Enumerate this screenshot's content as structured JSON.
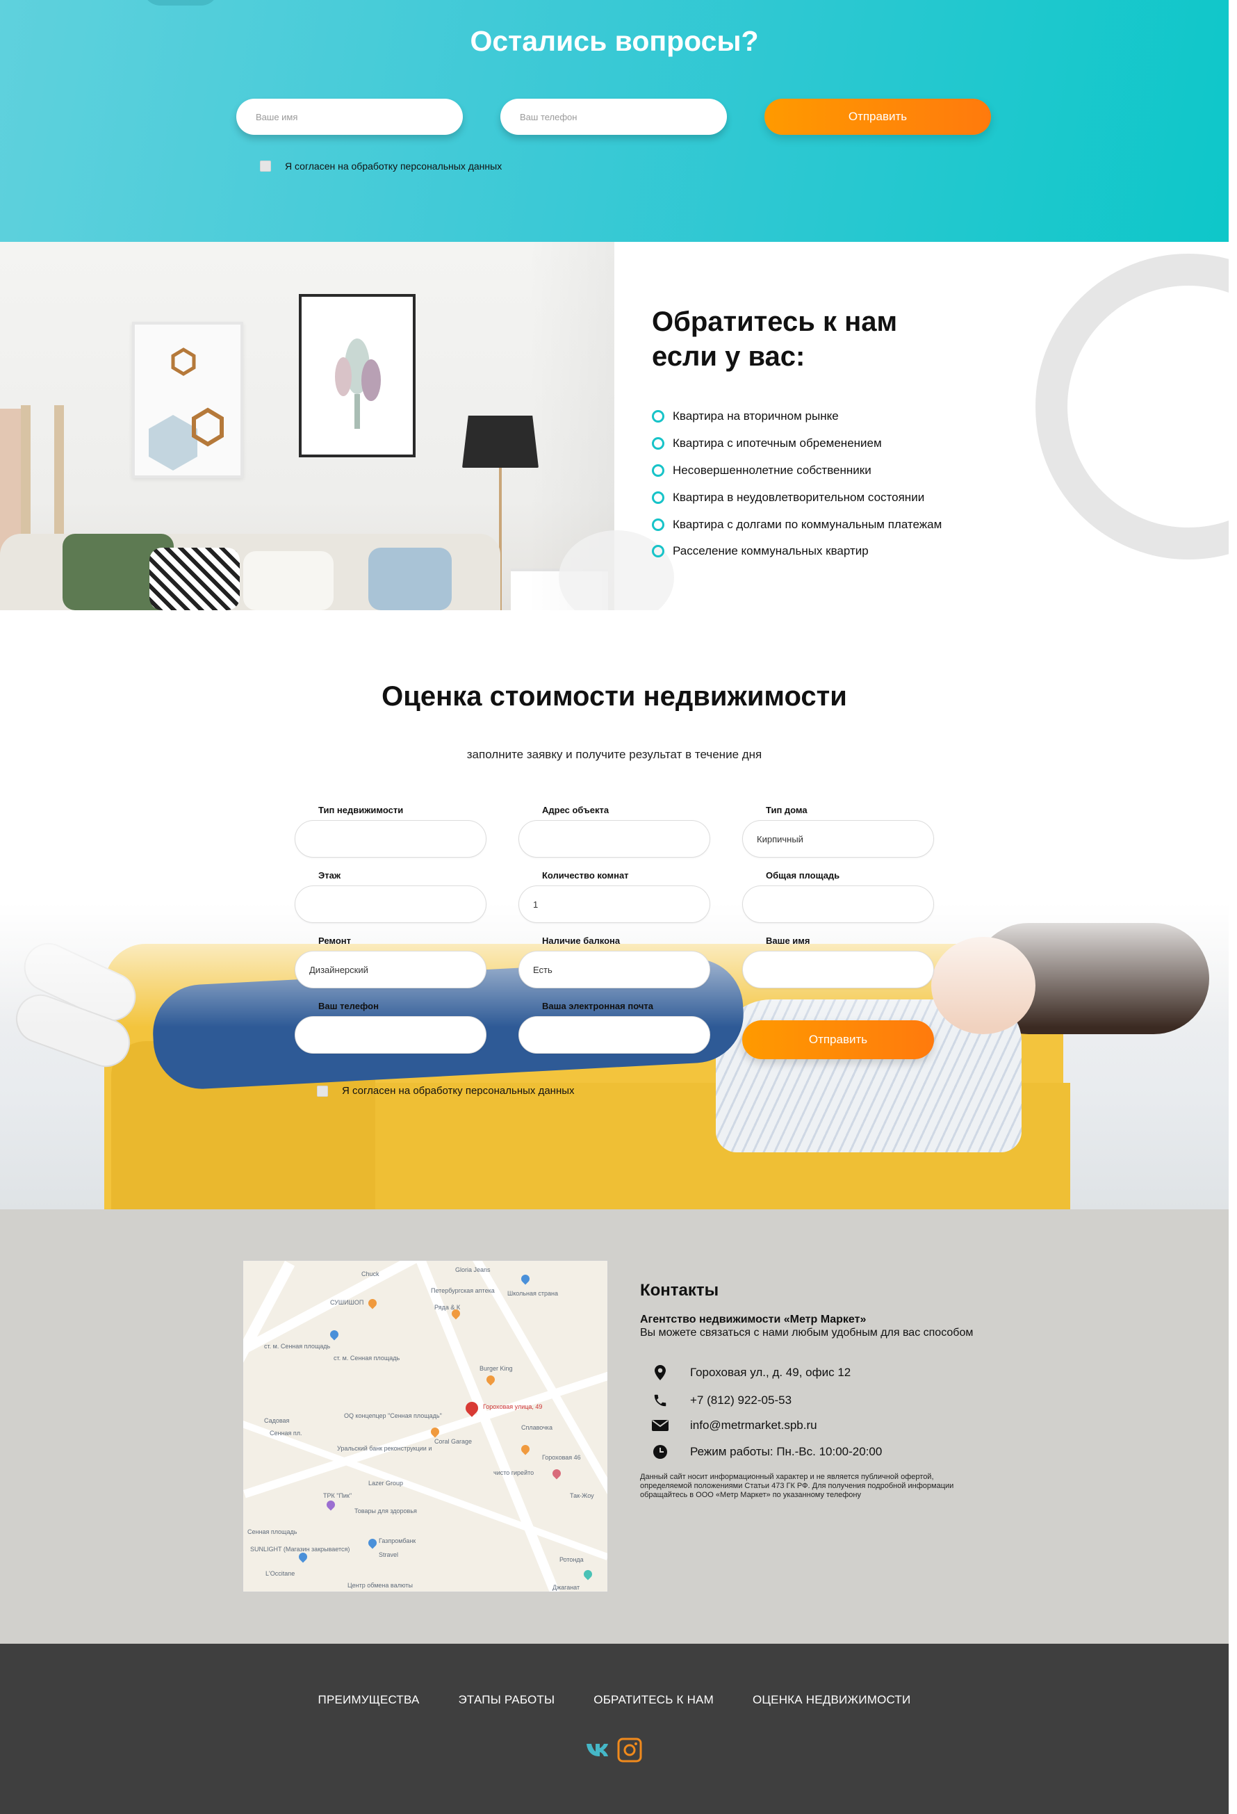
{
  "questions": {
    "title": "Остались вопросы?",
    "name_placeholder": "Ваше имя",
    "phone_placeholder": "Ваш телефон",
    "submit_label": "Отправить",
    "consent_label": "Я согласен на обработку персональных данных"
  },
  "contact_us": {
    "title_line1": "Обратитесь к нам",
    "title_line2": "если у вас:",
    "items": [
      "Квартира на вторичном рынке",
      "Квартира с ипотечным обременением",
      "Несовершеннолетние собственники",
      "Квартира в неудовлетворительном состоянии",
      "Квартира с долгами по коммунальным платежам",
      "Расселение коммунальных квартир"
    ],
    "accent_color": "#17c3c8"
  },
  "valuation": {
    "title": "Оценка стоимости недвижимости",
    "subtitle": "заполните заявку и получите результат в течение дня",
    "fields": {
      "property_type": {
        "label": "Тип недвижимости",
        "value": ""
      },
      "address": {
        "label": "Адрес объекта",
        "value": ""
      },
      "house_type": {
        "label": "Тип дома",
        "value": "Кирпичный"
      },
      "floor": {
        "label": "Этаж",
        "value": ""
      },
      "rooms": {
        "label": "Количество комнат",
        "value": "1"
      },
      "area": {
        "label": "Общая площадь",
        "value": ""
      },
      "repair": {
        "label": "Ремонт",
        "value": "Дизайнерский"
      },
      "balcony": {
        "label": "Наличие балкона",
        "value": "Есть"
      },
      "name": {
        "label": "Ваше имя",
        "value": ""
      },
      "phone": {
        "label": "Ваш телефон",
        "value": ""
      },
      "email": {
        "label": "Ваша электронная почта",
        "value": ""
      }
    },
    "submit_label": "Отправить",
    "consent_label": "Я согласен на обработку персональных данных"
  },
  "contacts": {
    "title": "Контакты",
    "agency": "Агентство недвижимости «Метр Маркет»",
    "agency_sub": "Вы можете связаться с нами любым удобным для вас способом",
    "address": "Гороховая ул., д. 49, офис 12",
    "phone": "+7 (812) 922-05-53",
    "email": "info@metrmarket.spb.ru",
    "hours": "Режим работы: Пн.-Вс. 10:00-20:00",
    "disclaimer": "Данный сайт носит информационный характер и не является публичной офертой, определяемой положениями Статьи 473 ГК РФ. Для получения подробной информации обращайтесь в ООО «Метр Маркет» по указанному телефону",
    "map": {
      "labels": [
        "Gloria Jeans",
        "Chuck",
        "Петербургская аптека",
        "Школьная страна",
        "СУШИШОП",
        "Ряда & К",
        "ст. м. Сенная площадь",
        "ст. м. Сенная площадь",
        "Burger King",
        "Садовая",
        "Сенная пл.",
        "Гороховая улица, 49",
        "OQ концепцер \"Сенная площадь\"",
        "Сплавочка",
        "Coral Garage",
        "Уральский банк реконструкции и",
        "Гороховая 46",
        "Lazer Group",
        "чисто гирейто",
        "ТРК \"Пик\"",
        "Товары для здоровья",
        "Так-Жоу",
        "Сенная площадь",
        "SUNLIGHT (Магазин закрывается)",
        "Газпромбанк",
        "Stravel",
        "Ротонда",
        "L'Occitane",
        "Центр обмена валюты",
        "Джаганат"
      ]
    }
  },
  "footer": {
    "nav": [
      "ПРЕИМУЩЕСТВА",
      "ЭТАПЫ РАБОТЫ",
      "ОБРАТИТЕСЬ К НАМ",
      "ОЦЕНКА НЕДВИЖИМОСТИ"
    ],
    "social": [
      "vk-icon",
      "instagram-icon"
    ],
    "vk_color": "#45b7c7",
    "instagram_color": "#f08a1c"
  }
}
